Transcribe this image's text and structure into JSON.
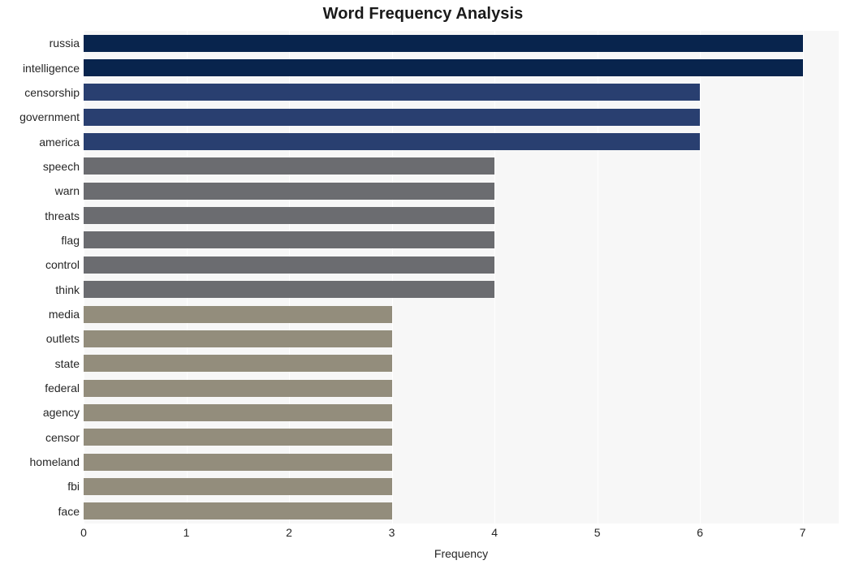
{
  "chart_data": {
    "type": "bar",
    "orientation": "horizontal",
    "title": "Word Frequency Analysis",
    "xlabel": "Frequency",
    "ylabel": "",
    "xlim": [
      0,
      7.35
    ],
    "xticks": [
      0,
      1,
      2,
      3,
      4,
      5,
      6,
      7
    ],
    "xtick_labels": [
      "0",
      "1",
      "2",
      "3",
      "4",
      "5",
      "6",
      "7"
    ],
    "grid": "vertical",
    "legend": "none",
    "categories": [
      "russia",
      "intelligence",
      "censorship",
      "government",
      "america",
      "speech",
      "warn",
      "threats",
      "flag",
      "control",
      "think",
      "media",
      "outlets",
      "state",
      "federal",
      "agency",
      "censor",
      "homeland",
      "fbi",
      "face"
    ],
    "values": [
      7,
      7,
      6,
      6,
      6,
      4,
      4,
      4,
      4,
      4,
      4,
      3,
      3,
      3,
      3,
      3,
      3,
      3,
      3,
      3
    ],
    "bar_colors": [
      "#08244d",
      "#08244d",
      "#293f70",
      "#293f70",
      "#293f70",
      "#6b6c70",
      "#6b6c70",
      "#6b6c70",
      "#6b6c70",
      "#6b6c70",
      "#6b6c70",
      "#938d7c",
      "#938d7c",
      "#938d7c",
      "#938d7c",
      "#938d7c",
      "#938d7c",
      "#938d7c",
      "#938d7c",
      "#938d7c"
    ]
  },
  "colors": {
    "plot_background": "#f7f7f7",
    "figure_background": "#ffffff",
    "gridline": "#ffffff",
    "text": "#262626",
    "title": "#1a1a1a",
    "tier1": "#08244d",
    "tier2": "#293f70",
    "tier3": "#6b6c70",
    "tier4": "#938d7c"
  }
}
